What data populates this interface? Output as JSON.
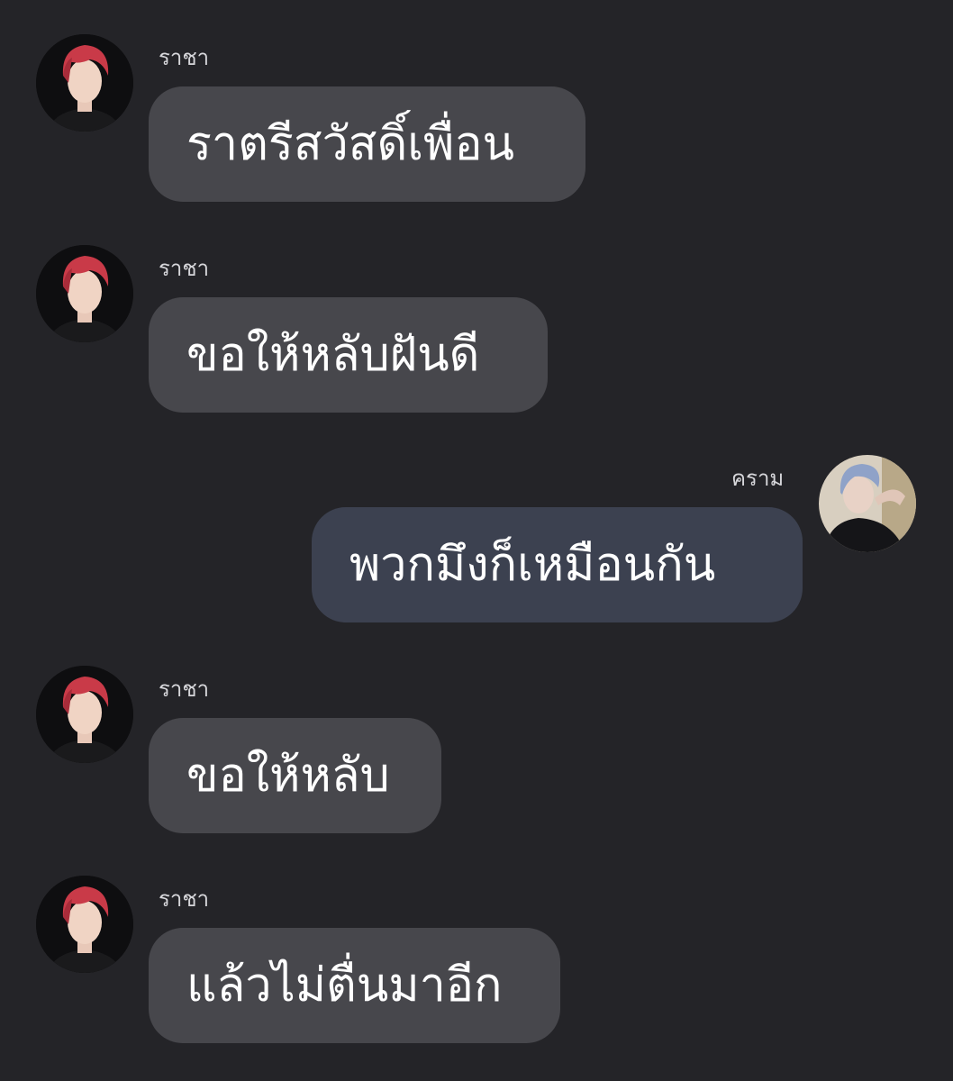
{
  "messages": [
    {
      "sender": "ราชา",
      "text": "ราตรีสวัสดิ์เพื่อน",
      "avatar": "red-hair-avatar",
      "direction": "incoming"
    },
    {
      "sender": "ราชา",
      "text": "ขอให้หลับฝันดี",
      "avatar": "red-hair-avatar",
      "direction": "incoming"
    },
    {
      "sender": "คราม",
      "text": "พวกมึงก็เหมือนกัน",
      "avatar": "blue-hair-avatar",
      "direction": "outgoing"
    },
    {
      "sender": "ราชา",
      "text": "ขอให้หลับ",
      "avatar": "red-hair-avatar",
      "direction": "incoming"
    },
    {
      "sender": "ราชา",
      "text": "แล้วไม่ตื่นมาอีก",
      "avatar": "red-hair-avatar",
      "direction": "incoming"
    }
  ],
  "colors": {
    "background": "#242428",
    "incoming_bubble": "#47474c",
    "outgoing_bubble": "#3c4150",
    "text": "#ffffff",
    "name_text": "#d6d6da"
  }
}
